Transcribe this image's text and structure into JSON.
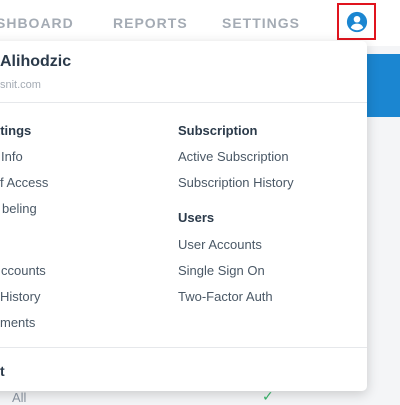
{
  "nav": {
    "items": [
      "SHBOARD",
      "REPORTS",
      "SETTINGS"
    ]
  },
  "profile": {
    "icon": "account-circle-icon",
    "name": "Alihodzic",
    "email": "snit.com"
  },
  "menu": {
    "left": {
      "heading": "Settings",
      "items": [
        "Info",
        "f Access",
        "beling",
        "ccounts",
        "History",
        "ments"
      ]
    },
    "subscription": {
      "heading": "Subscription",
      "items": [
        "Active Subscription",
        "Subscription History"
      ]
    },
    "users": {
      "heading": "Users",
      "items": [
        "User Accounts",
        "Single Sign On",
        "Two-Factor Auth"
      ]
    },
    "footer": "t"
  },
  "background": {
    "partial_text": "All"
  },
  "colors": {
    "accent": "#1b86d1",
    "highlight_border": "#e0141e",
    "nav_text": "#a4abb4"
  }
}
